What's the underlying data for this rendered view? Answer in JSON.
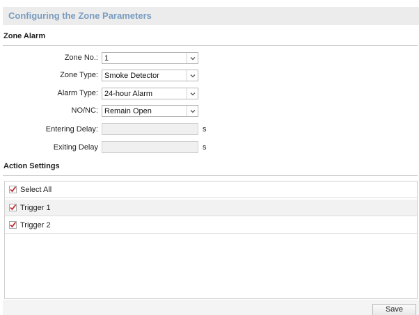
{
  "page": {
    "title": "Configuring the Zone Parameters"
  },
  "zone_alarm": {
    "header": "Zone Alarm",
    "zone_no": {
      "label": "Zone No.:",
      "value": "1"
    },
    "zone_type": {
      "label": "Zone Type:",
      "value": "Smoke Detector"
    },
    "alarm_type": {
      "label": "Alarm Type:",
      "value": "24-hour Alarm"
    },
    "no_nc": {
      "label": "NO/NC:",
      "value": "Remain Open"
    },
    "entering_delay": {
      "label": "Entering Delay:",
      "value": "",
      "unit": "s"
    },
    "exiting_delay": {
      "label": "Exiting Delay",
      "value": "",
      "unit": "s"
    }
  },
  "action_settings": {
    "header": "Action Settings",
    "select_all": {
      "label": "Select All",
      "checked": true
    },
    "items": [
      {
        "label": "Trigger 1",
        "checked": true
      },
      {
        "label": "Trigger 2",
        "checked": true
      }
    ]
  },
  "footer": {
    "save_label": "Save"
  },
  "colors": {
    "title": "#7a9cbf",
    "check": "#c0282d"
  },
  "icons": {
    "dropdown": "chevron-down-icon",
    "checkbox": "check-icon"
  }
}
